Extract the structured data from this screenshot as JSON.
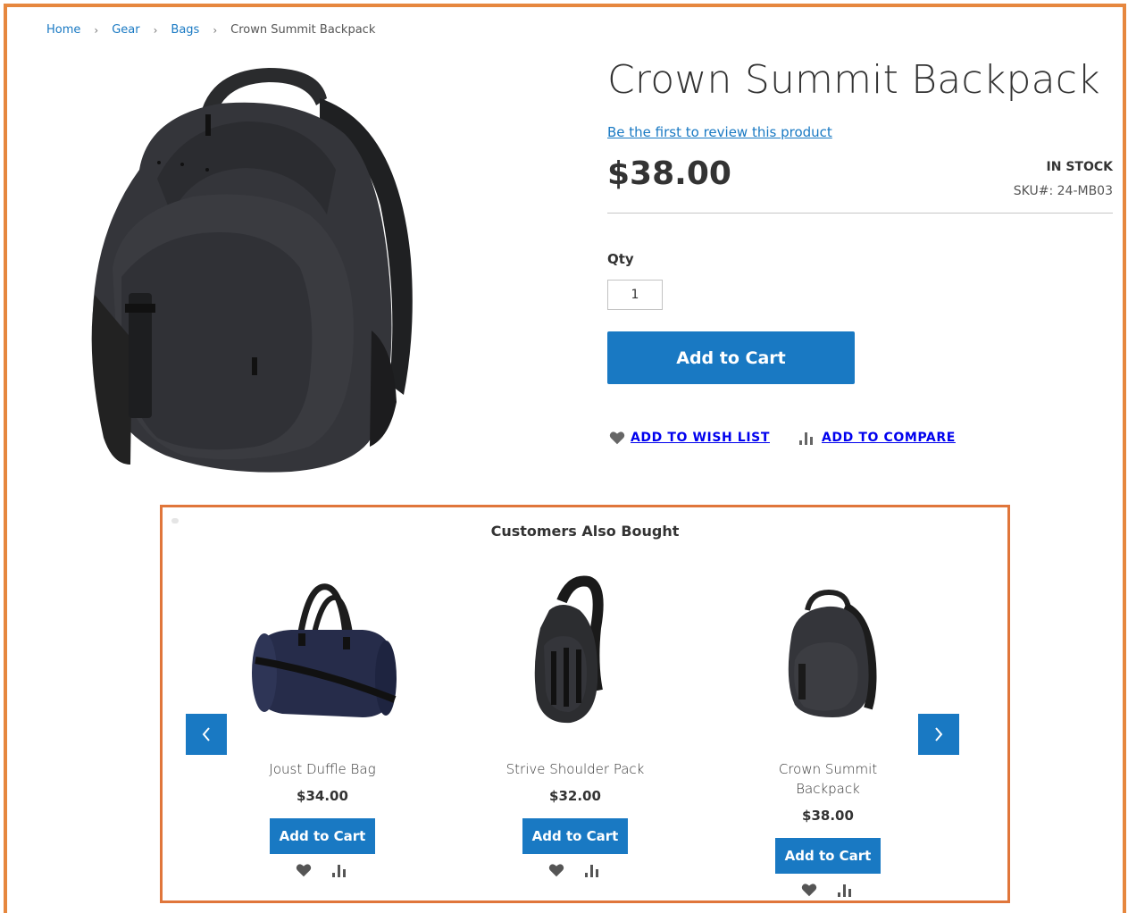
{
  "breadcrumb": [
    "Home",
    "Gear",
    "Bags",
    "Crown Summit Backpack"
  ],
  "product": {
    "title": "Crown Summit Backpack",
    "review_link": "Be the first to review this product",
    "price": "$38.00",
    "stock": "IN STOCK",
    "sku_label": "SKU#:",
    "sku": "24-MB03",
    "qty_label": "Qty",
    "qty_value": "1",
    "add_to_cart": "Add to Cart",
    "wish_list": "ADD TO WISH LIST",
    "compare": "ADD TO COMPARE"
  },
  "related": {
    "title": "Customers Also Bought",
    "items": [
      {
        "name": "Joust Duffle Bag",
        "price": "$34.00",
        "button": "Add to Cart"
      },
      {
        "name": "Strive Shoulder Pack",
        "price": "$32.00",
        "button": "Add to Cart"
      },
      {
        "name": "Crown Summit Backpack",
        "price": "$38.00",
        "button": "Add to Cart"
      }
    ]
  },
  "colors": {
    "accent": "#1979c3",
    "frame": "#e6873e",
    "backpack": "#2f3033"
  }
}
